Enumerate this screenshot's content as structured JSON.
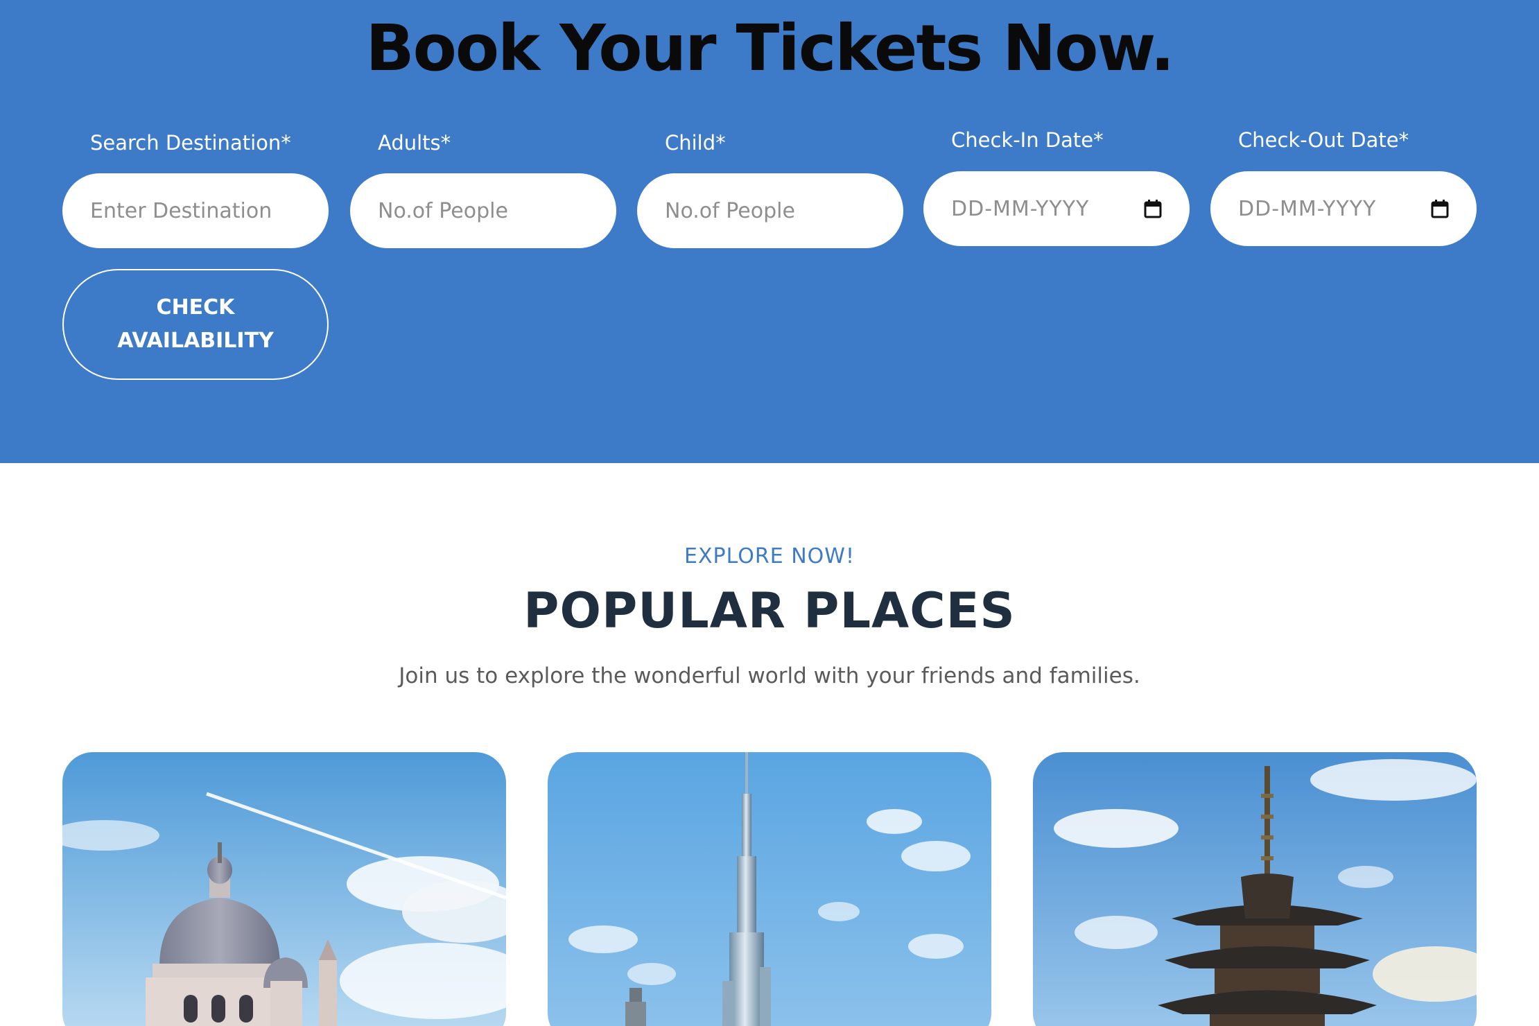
{
  "booking": {
    "title": "Book Your Tickets Now.",
    "fields": [
      {
        "label": "Search Destination*",
        "placeholder": "Enter Destination"
      },
      {
        "label": "Adults*",
        "placeholder": "No.of People"
      },
      {
        "label": "Child*",
        "placeholder": "No.of People"
      },
      {
        "label": "Check-In Date*",
        "placeholder": "DD-MM-YYYY",
        "icon": "calendar-icon"
      },
      {
        "label": "Check-Out Date*",
        "placeholder": "DD-MM-YYYY",
        "icon": "calendar-icon"
      }
    ],
    "submit_label": "CHECK AVAILABILITY"
  },
  "popular": {
    "eyebrow": "EXPLORE NOW!",
    "title": "POPULAR PLACES",
    "subtitle": "Join us to explore the wonderful world with your friends and families.",
    "cards": [
      {
        "image": "domed-basilica-photo"
      },
      {
        "image": "skyscraper-tower-photo"
      },
      {
        "image": "pagoda-photo"
      }
    ]
  },
  "colors": {
    "accent": "#3d7bc9",
    "title_dark": "#1f2f3f",
    "white": "#ffffff"
  }
}
